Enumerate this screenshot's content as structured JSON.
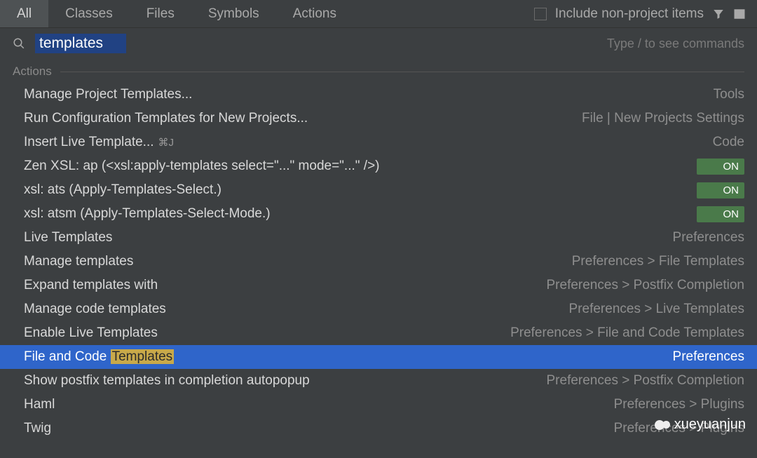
{
  "header": {
    "tabs": [
      "All",
      "Classes",
      "Files",
      "Symbols",
      "Actions"
    ],
    "active_tab_index": 0,
    "include_non_project": "Include non-project items"
  },
  "search": {
    "query": "templates",
    "hint": "Type / to see commands"
  },
  "section": {
    "title": "Actions"
  },
  "results": [
    {
      "label": "Manage Project Templates...",
      "right": "Tools",
      "type": "text"
    },
    {
      "label": "Run Configuration Templates for New Projects...",
      "right": "File | New Projects Settings",
      "type": "text"
    },
    {
      "label": "Insert Live Template...",
      "shortcut": "⌘J",
      "right": "Code",
      "type": "text"
    },
    {
      "label": "Zen XSL: ap (<xsl:apply-templates select=\"...\" mode=\"...\" />)",
      "right": "ON",
      "type": "toggle"
    },
    {
      "label": "xsl: ats (Apply-Templates-Select.)",
      "right": "ON",
      "type": "toggle"
    },
    {
      "label": "xsl: atsm (Apply-Templates-Select-Mode.)",
      "right": "ON",
      "type": "toggle"
    },
    {
      "label": "Live Templates",
      "right": "Preferences",
      "type": "text"
    },
    {
      "label": "Manage templates",
      "right": "Preferences > File Templates",
      "type": "text"
    },
    {
      "label": "Expand templates with",
      "right": "Preferences > Postfix Completion",
      "type": "text"
    },
    {
      "label": "Manage code templates",
      "right": "Preferences > Live Templates",
      "type": "text"
    },
    {
      "label": "Enable Live Templates",
      "right": "Preferences > File and Code Templates",
      "type": "text"
    },
    {
      "label_pre": "File and Code ",
      "label_hl": "Templates",
      "right": "Preferences",
      "type": "text",
      "selected": true
    },
    {
      "label": "Show postfix templates in completion autopopup",
      "right": "Preferences > Postfix Completion",
      "type": "text"
    },
    {
      "label": "Haml",
      "right": "Preferences > Plugins",
      "type": "text"
    },
    {
      "label": "Twig",
      "right": "Preferences > Plugins",
      "type": "text"
    }
  ],
  "watermark": "xueyuanjun"
}
